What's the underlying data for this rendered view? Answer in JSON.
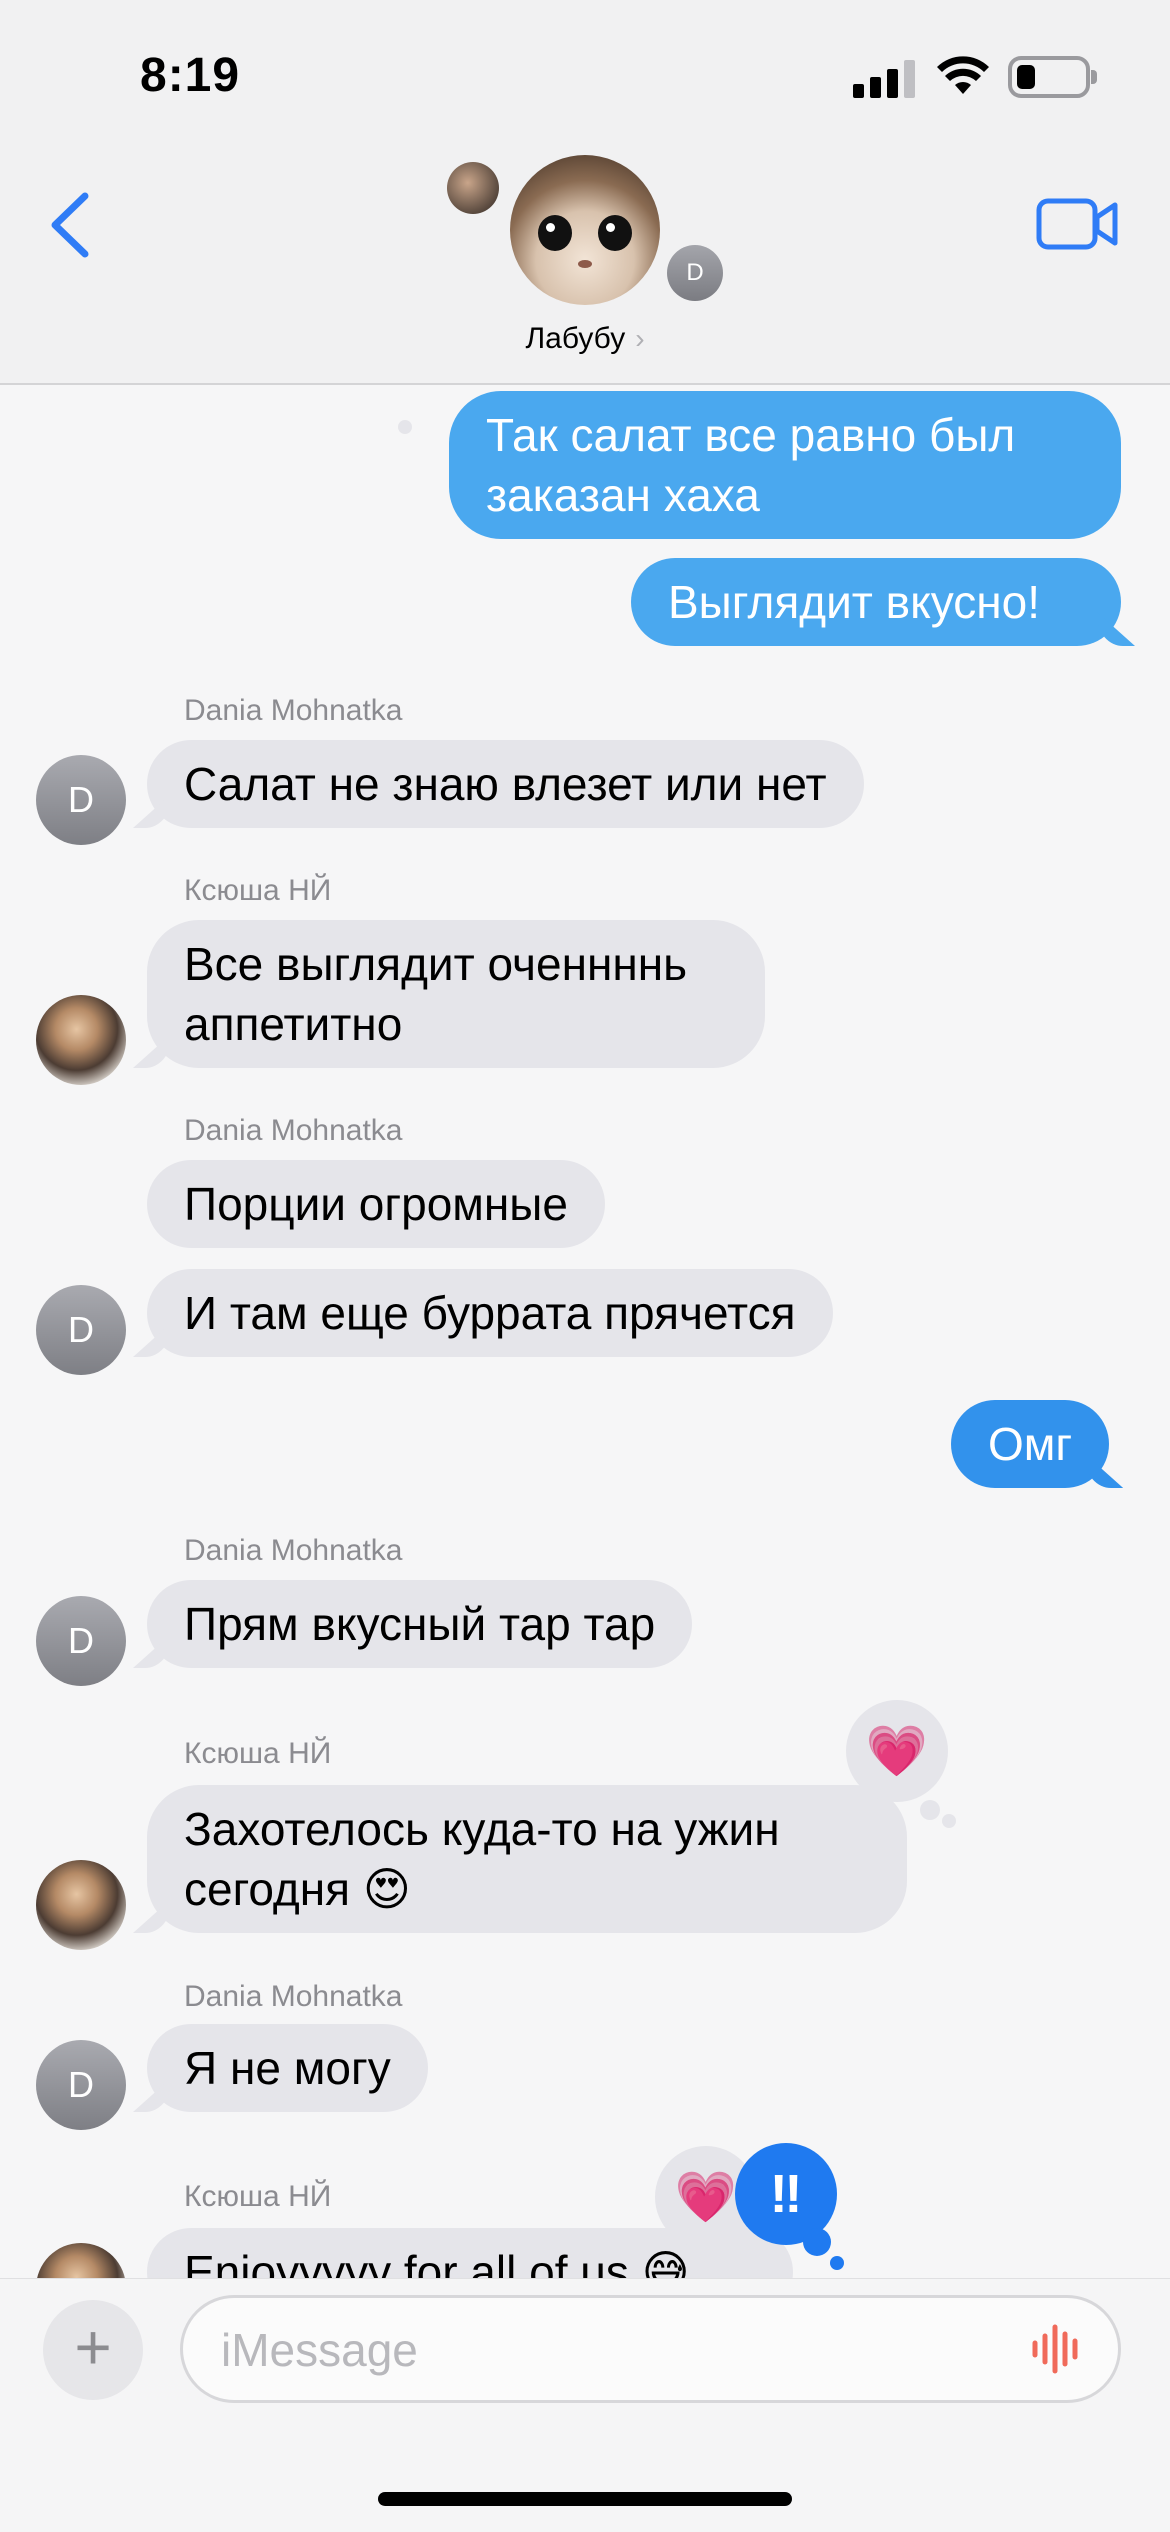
{
  "status_bar": {
    "time": "8:19"
  },
  "header": {
    "group_name": "Лабубу",
    "chevron": "›",
    "member_initial": "D"
  },
  "messages": [
    {
      "type": "sent",
      "text": "Так салат все равно был заказан хаха"
    },
    {
      "type": "sent",
      "text": "Выглядит вкусно!"
    },
    {
      "type": "received",
      "sender": "Dania Mohnatka",
      "initial": "D",
      "text": "Салат не знаю влезет или нет"
    },
    {
      "type": "received",
      "sender": "Ксюша НЙ",
      "text": "Все выглядит оченнннь аппетитно"
    },
    {
      "type": "received",
      "sender": "Dania Mohnatka",
      "text": "Порции огромные"
    },
    {
      "type": "received",
      "initial": "D",
      "text": "И там еще буррата прячется"
    },
    {
      "type": "sent",
      "text": "Омг"
    },
    {
      "type": "received",
      "sender": "Dania Mohnatka",
      "initial": "D",
      "text": "Прям вкусный тар тар"
    },
    {
      "type": "received",
      "sender": "Ксюша НЙ",
      "text": "Захотелось куда-то на ужин сегодня 😍",
      "tapback": "💗"
    },
    {
      "type": "received",
      "sender": "Dania Mohnatka",
      "initial": "D",
      "text": "Я не могу"
    },
    {
      "type": "received",
      "sender": "Ксюша НЙ",
      "text": "Enjoyyyyy for all of us 😅",
      "tapbacks": [
        "💗",
        "‼"
      ]
    }
  ],
  "composer": {
    "plus": "+",
    "placeholder": "iMessage"
  },
  "colors": {
    "sent_bubble": "#4aa8ef",
    "received_bubble": "#e5e5ea",
    "accent": "#1f7af0"
  },
  "icons": [
    "back-chevron-icon",
    "video-camera-icon",
    "cellular-signal-icon",
    "wifi-icon",
    "battery-icon",
    "audio-waveform-icon"
  ]
}
